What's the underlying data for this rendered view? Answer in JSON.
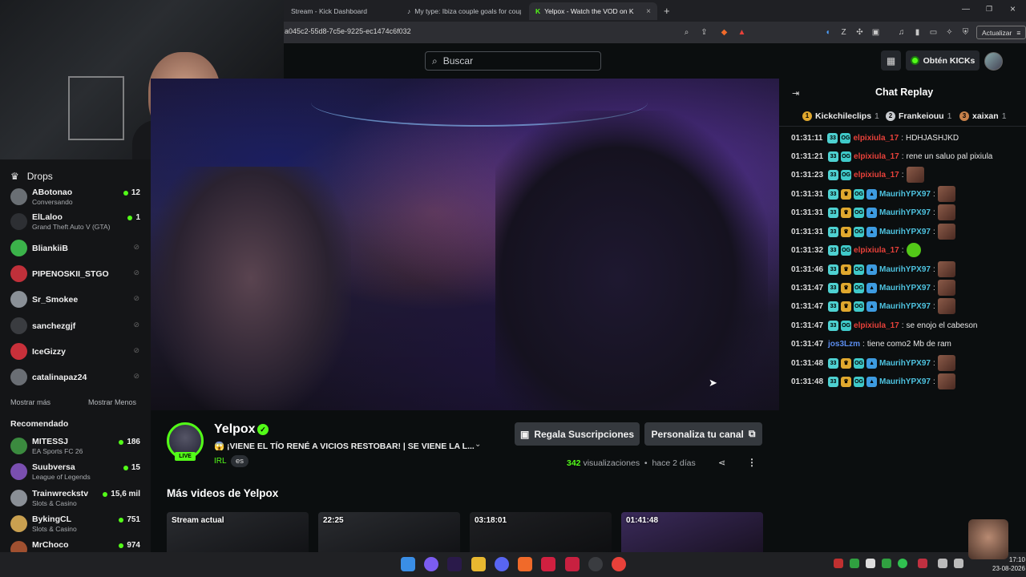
{
  "browser": {
    "tabs": [
      {
        "label": "Stream - Kick Dashboard"
      },
      {
        "label": "My type: Ibiza couple goals for coup"
      },
      {
        "label": "Yelpox - Watch the VOD on K"
      }
    ],
    "url": "a045c2-55d8-7c5e-9225-ec1474c6f032",
    "update_label": "Actualizar"
  },
  "header": {
    "search_placeholder": "Buscar",
    "kicks_label": "Obtén KICKs"
  },
  "sidebar": {
    "drops_label": "Drops",
    "following": [
      {
        "name": "ABotonao",
        "game": "Conversando",
        "viewers": "12",
        "color": "#6a6f74"
      },
      {
        "name": "ElLaloo",
        "game": "Grand Theft Auto V (GTA)",
        "viewers": "1",
        "color": "#2d2f33"
      },
      {
        "name": "BliankiiB",
        "game": "",
        "viewers": "",
        "color": "#3bb34a"
      },
      {
        "name": "PIPENOSKII_STGO",
        "game": "",
        "viewers": "",
        "color": "#c0303a"
      },
      {
        "name": "Sr_Smokee",
        "game": "",
        "viewers": "",
        "color": "#8a9097"
      },
      {
        "name": "sanchezgjf",
        "game": "",
        "viewers": "",
        "color": "#3a3c40"
      },
      {
        "name": "IceGizzy",
        "game": "",
        "viewers": "",
        "color": "#c8303a"
      },
      {
        "name": "catalinapaz24",
        "game": "",
        "viewers": "",
        "color": "#6a6e74"
      }
    ],
    "show_more": "Mostrar más",
    "show_less": "Mostrar Menos",
    "recommended_label": "Recomendado",
    "recommended": [
      {
        "name": "MITESSJ",
        "game": "EA Sports FC 26",
        "viewers": "186",
        "color": "#3b8a3f"
      },
      {
        "name": "Suubversa",
        "game": "League of Legends",
        "viewers": "15",
        "color": "#7a4fb0"
      },
      {
        "name": "Trainwreckstv",
        "game": "Slots & Casino",
        "viewers": "15,6 mil",
        "color": "#8a8f96"
      },
      {
        "name": "BykingCL",
        "game": "Slots & Casino",
        "viewers": "751",
        "color": "#c9a050"
      },
      {
        "name": "MrChoco",
        "game": "",
        "viewers": "974",
        "color": "#a05030"
      }
    ]
  },
  "stream": {
    "streamer_name": "Yelpox",
    "live_label": "LIVE",
    "title": "😱 ¡VIENE EL TÍO RENÉ A VICIOS RESTOBAR! | SE VIENE LA L...",
    "category": "IRL",
    "language": "es",
    "gift_label": "Regala Suscripciones",
    "customize_label": "Personaliza tu canal",
    "views_count": "342",
    "views_label": "visualizaciones",
    "time_ago": "hace 2 días",
    "more_videos_label": "Más videos de Yelpox",
    "videos": [
      {
        "duration": "Stream actual"
      },
      {
        "duration": "22:25"
      },
      {
        "duration": "03:18:01"
      },
      {
        "duration": "01:41:48"
      }
    ]
  },
  "chat": {
    "title": "Chat Replay",
    "top_gifters": [
      {
        "rank": "1",
        "name": "Kickchileclips",
        "count": "1",
        "color": "#e0a82e"
      },
      {
        "rank": "2",
        "name": "Frankeiouu",
        "count": "1",
        "color": "#c9ccd0"
      },
      {
        "rank": "3",
        "name": "xaixan",
        "count": "1",
        "color": "#c8814a"
      }
    ],
    "messages": [
      {
        "ts": "01:31:11",
        "badges": [
          "sub",
          "og"
        ],
        "user": "elpixiula_17",
        "color": "#e8413a",
        "text": "HDHJASHJKD",
        "emote": ""
      },
      {
        "ts": "01:31:21",
        "badges": [
          "sub",
          "og"
        ],
        "user": "elpixiula_17",
        "color": "#e8413a",
        "text": "rene un saluo pal pixiula",
        "emote": ""
      },
      {
        "ts": "01:31:23",
        "badges": [
          "sub",
          "og"
        ],
        "user": "elpixiula_17",
        "color": "#e8413a",
        "text": "",
        "emote": "face"
      },
      {
        "ts": "01:31:31",
        "badges": [
          "sub",
          "crown",
          "og",
          "vip"
        ],
        "user": "MaurihYPX97",
        "color": "#4ec3e0",
        "text": "",
        "emote": "face"
      },
      {
        "ts": "01:31:31",
        "badges": [
          "sub",
          "crown",
          "og",
          "vip"
        ],
        "user": "MaurihYPX97",
        "color": "#4ec3e0",
        "text": "",
        "emote": "face"
      },
      {
        "ts": "01:31:31",
        "badges": [
          "sub",
          "crown",
          "og",
          "vip"
        ],
        "user": "MaurihYPX97",
        "color": "#4ec3e0",
        "text": "",
        "emote": "face"
      },
      {
        "ts": "01:31:32",
        "badges": [
          "sub",
          "og"
        ],
        "user": "elpixiula_17",
        "color": "#e8413a",
        "text": "",
        "emote": "green"
      },
      {
        "ts": "01:31:46",
        "badges": [
          "sub",
          "crown",
          "og",
          "vip"
        ],
        "user": "MaurihYPX97",
        "color": "#4ec3e0",
        "text": "",
        "emote": "face"
      },
      {
        "ts": "01:31:47",
        "badges": [
          "sub",
          "crown",
          "og",
          "vip"
        ],
        "user": "MaurihYPX97",
        "color": "#4ec3e0",
        "text": "",
        "emote": "face"
      },
      {
        "ts": "01:31:47",
        "badges": [
          "sub",
          "crown",
          "og",
          "vip"
        ],
        "user": "MaurihYPX97",
        "color": "#4ec3e0",
        "text": "",
        "emote": "face"
      },
      {
        "ts": "01:31:47",
        "badges": [
          "sub",
          "og"
        ],
        "user": "elpixiula_17",
        "color": "#e8413a",
        "text": "se enojo el cabeson",
        "emote": ""
      },
      {
        "ts": "01:31:47",
        "badges": [],
        "user": "jos3Lzm",
        "color": "#5b8ef0",
        "text": "tiene como2 Mb de ram",
        "emote": ""
      },
      {
        "ts": "01:31:48",
        "badges": [
          "sub",
          "crown",
          "og",
          "vip"
        ],
        "user": "MaurihYPX97",
        "color": "#4ec3e0",
        "text": "",
        "emote": "face"
      },
      {
        "ts": "01:31:48",
        "badges": [
          "sub",
          "crown",
          "og",
          "vip"
        ],
        "user": "MaurihYPX97",
        "color": "#4ec3e0",
        "text": "",
        "emote": "face"
      }
    ]
  },
  "taskbar": {
    "time": "17:10",
    "date": "23-08-2026"
  }
}
